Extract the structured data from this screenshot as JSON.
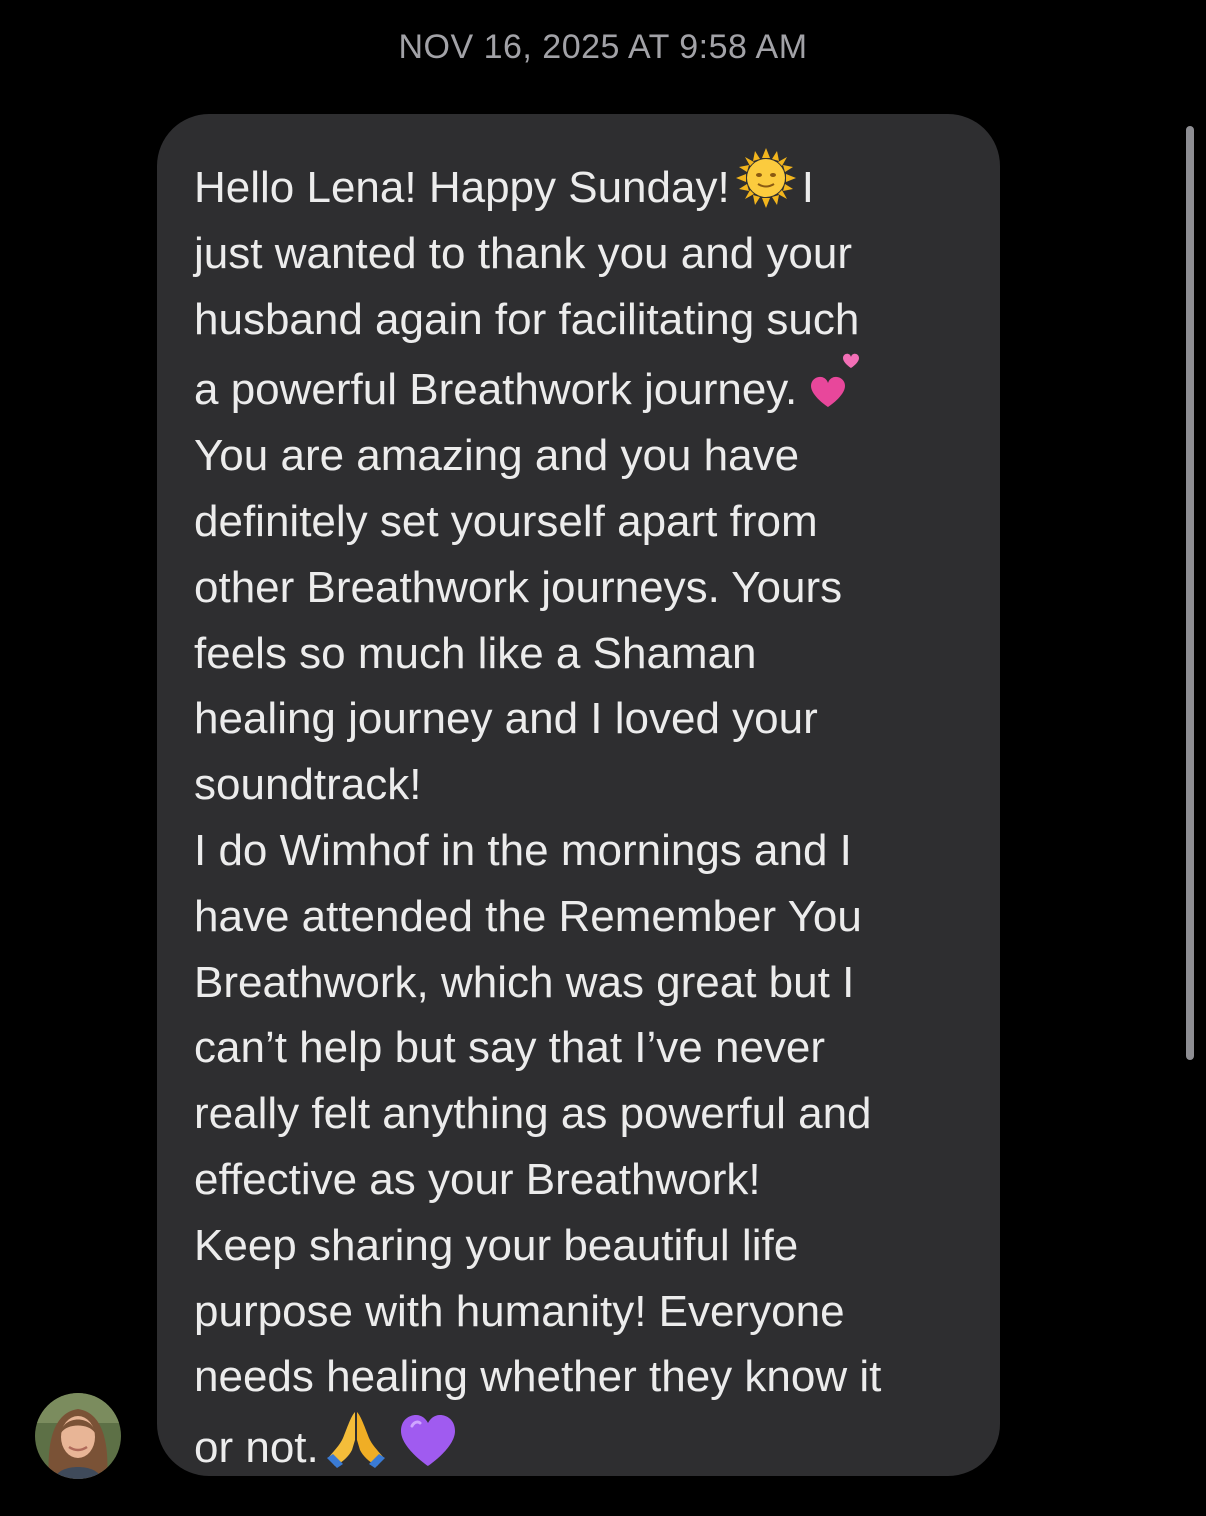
{
  "conversation": {
    "timestamp": "NOV 16, 2025 AT 9:58 AM"
  },
  "message": {
    "lines": [
      "Hello Lena! Happy Sunday!",
      "I",
      "just wanted to thank you and your",
      "husband again for facilitating such",
      "a powerful Breathwork journey.",
      "You are amazing and you have",
      "definitely set yourself apart from",
      "other Breathwork journeys. Yours",
      "feels so much like a Shaman",
      "healing journey and I loved your",
      "soundtrack!",
      "I do Wimhof in the mornings and I",
      "have attended the Remember You",
      "Breathwork, which was great but I",
      "can’t help but say that I’ve never",
      "really felt anything as powerful and",
      "effective as your Breathwork!",
      "Keep sharing your beautiful life",
      "purpose with humanity! Everyone",
      "needs healing whether they know it",
      "or not."
    ],
    "emojis": {
      "sun": "sun-with-face-icon",
      "hearts": "two-hearts-icon",
      "pray": "folded-hands-icon",
      "purple_heart": "purple-heart-icon"
    }
  },
  "colors": {
    "background": "#000000",
    "bubble": "#2e2e30",
    "text": "#ececec",
    "timestamp": "#a2a2a7",
    "scrollbar": "#8e8e93"
  }
}
